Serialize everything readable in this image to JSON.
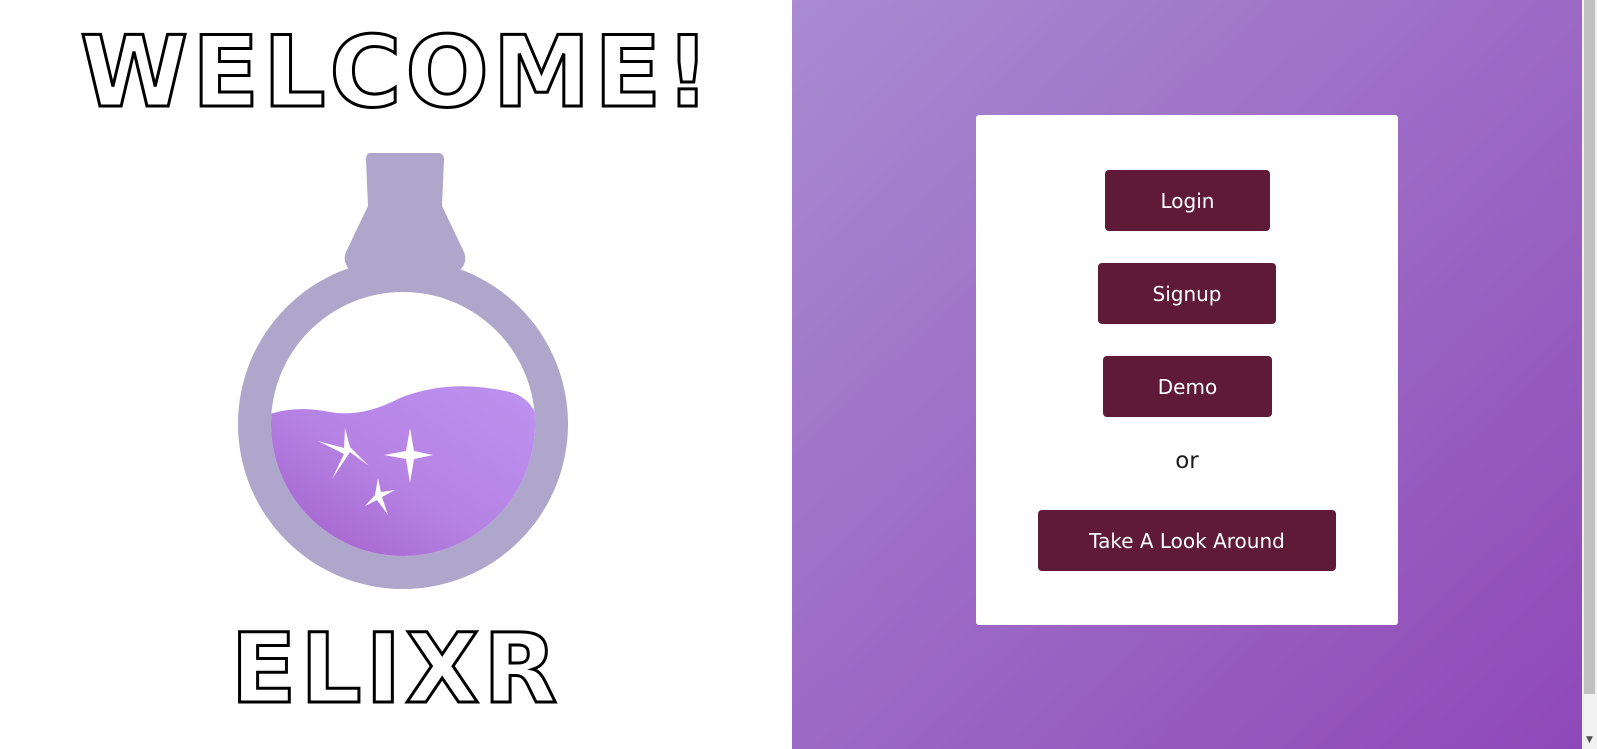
{
  "welcome": {
    "heading": "WELCOME!"
  },
  "logo": {
    "name": "potion-flask-icon",
    "text": "ELIXR"
  },
  "auth": {
    "login_label": "Login",
    "signup_label": "Signup",
    "demo_label": "Demo",
    "or_text": "or",
    "explore_label": "Take A Look Around"
  },
  "colors": {
    "button_bg": "#5e1a37",
    "button_text": "#ffffff",
    "gradient_start": "#a98bd2",
    "gradient_end": "#8f48b8",
    "flask_outline": "#aea6cb",
    "potion_light": "#ba8cee",
    "potion_dark": "#9e58c6"
  }
}
